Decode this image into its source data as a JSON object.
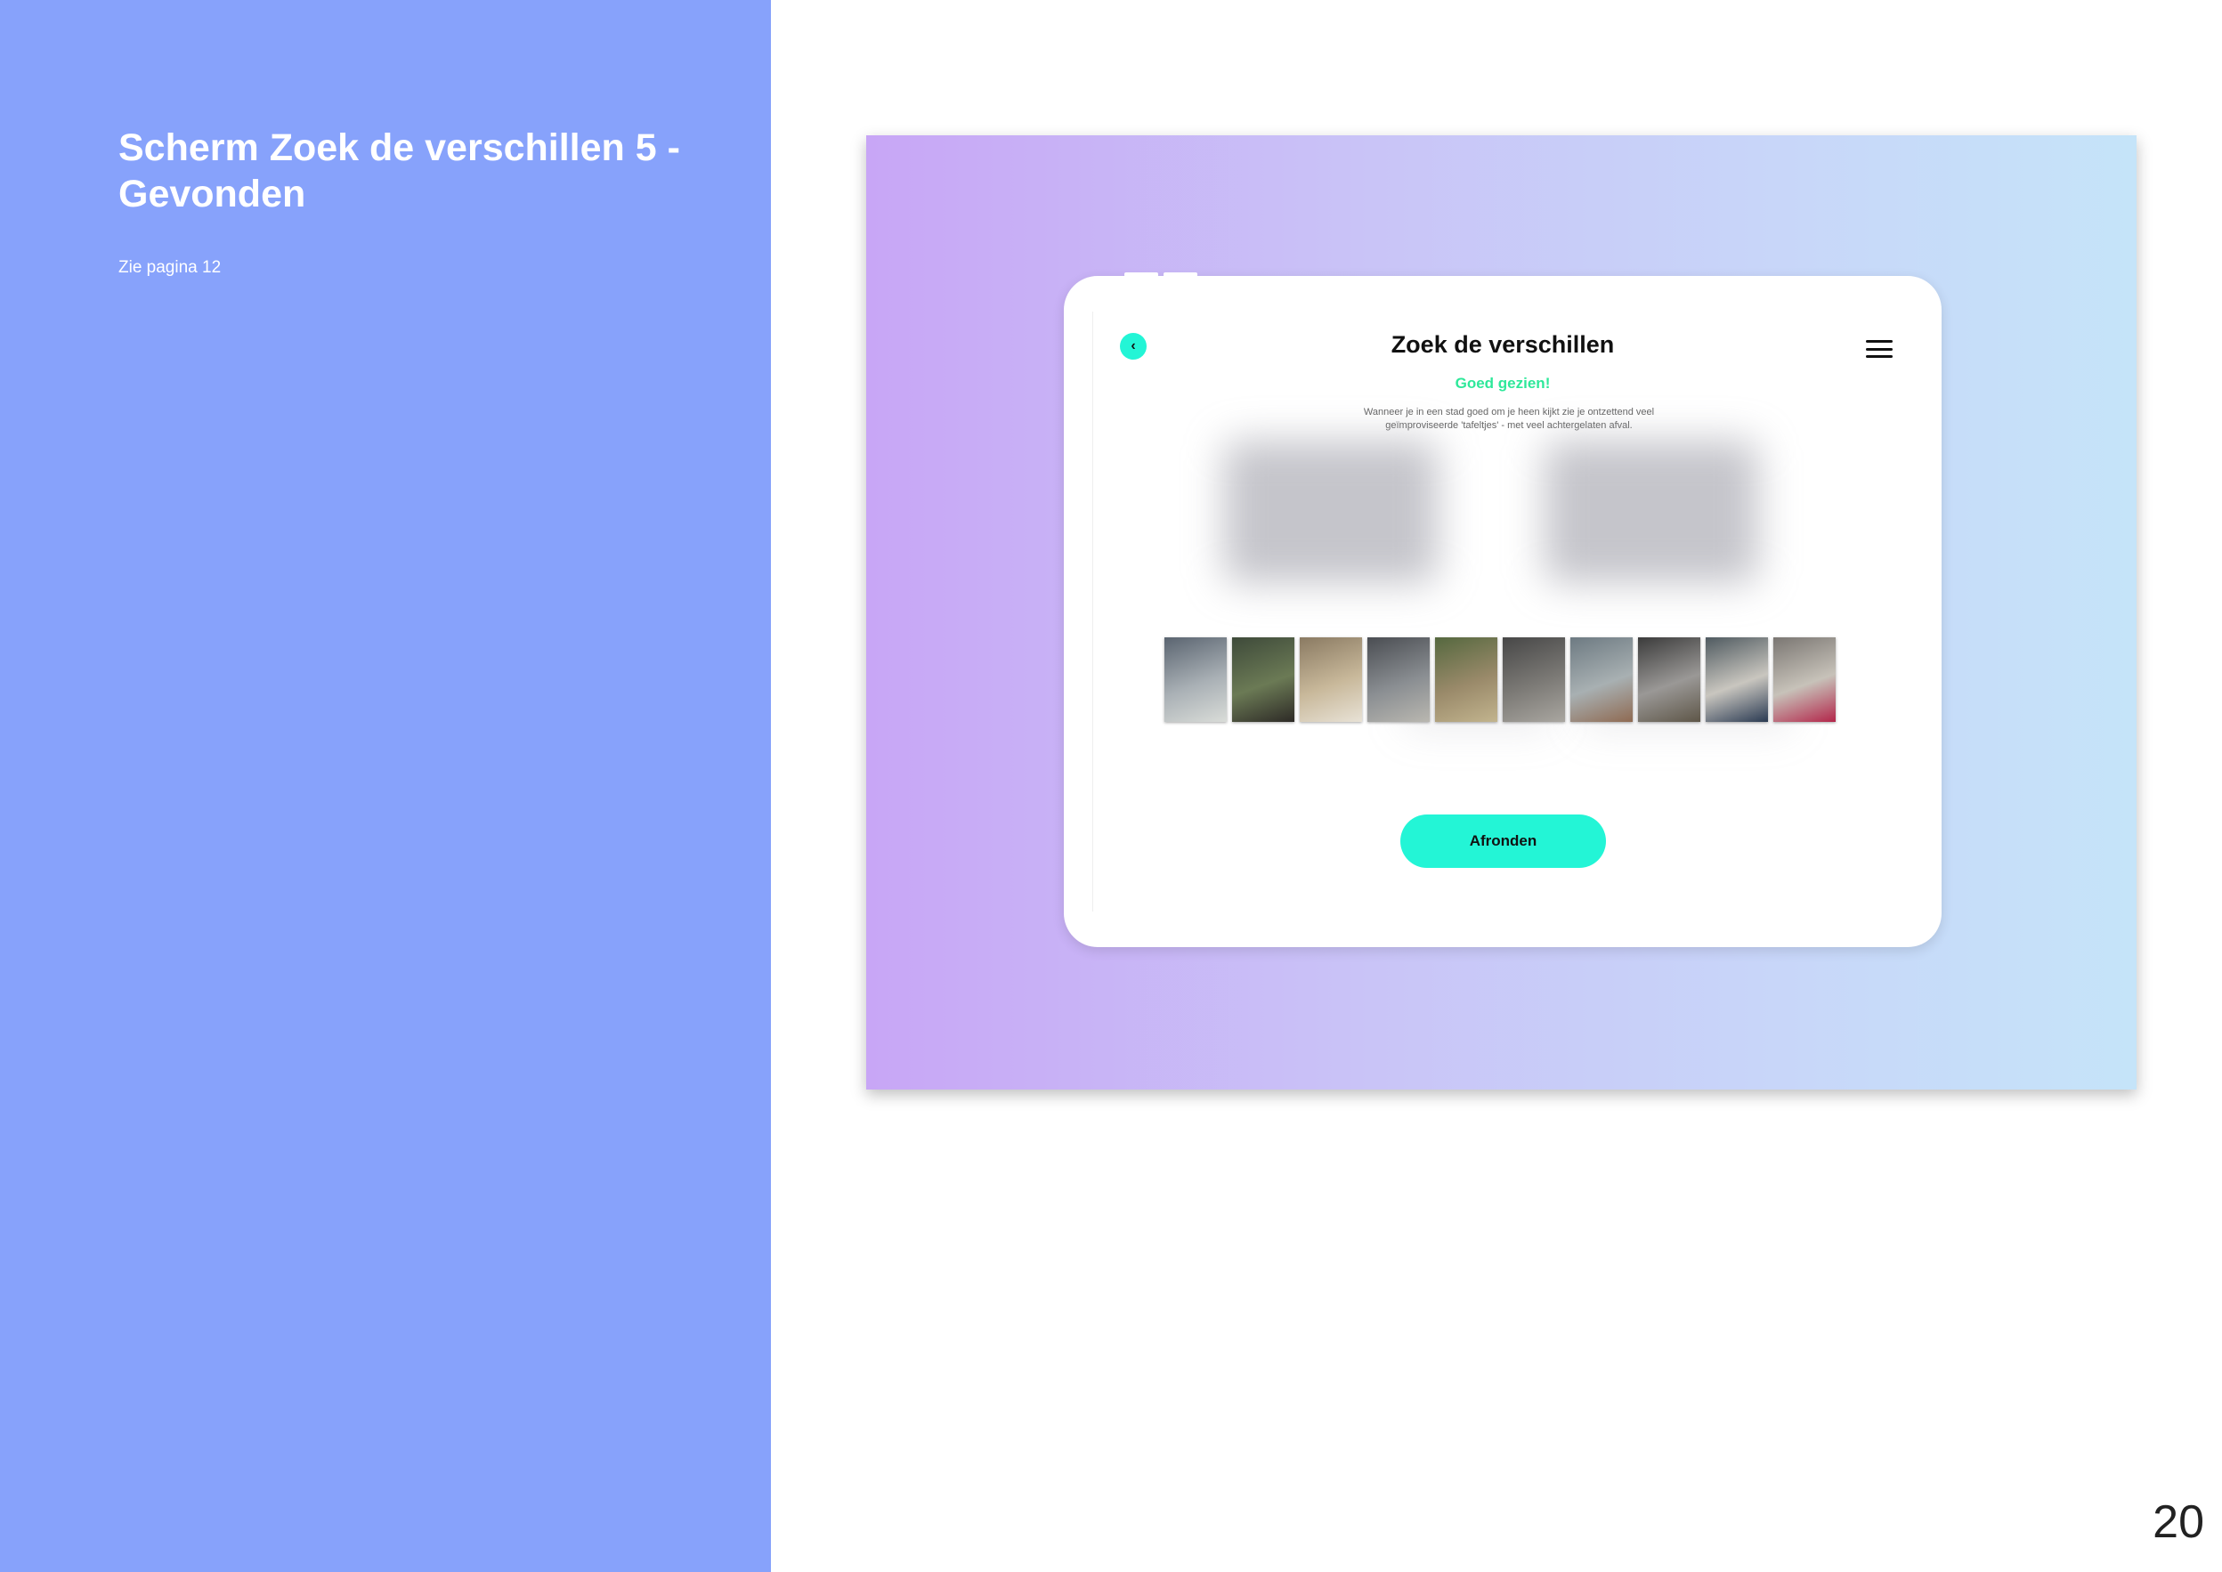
{
  "slide": {
    "title_line1": "Scherm Zoek de verschillen 5  -",
    "title_line2": "Gevonden",
    "subtitle": "Zie pagina 12",
    "page_number": "20",
    "panel_color": "#87a2fb"
  },
  "app": {
    "title": "Zoek de verschillen",
    "back_icon": "chevron-left-icon",
    "menu_icon": "hamburger-menu-icon",
    "status": "Goed gezien!",
    "description_line1": "Wanneer je in een stad goed om je heen kijkt zie je ontzettend veel",
    "description_line2": "geïmproviseerde  'tafeltjes' - met veel achtergelaten afval.",
    "done_label": "Afronden",
    "accent_color": "#23f5d6",
    "status_color": "#2ee89a"
  },
  "thumbnails": [
    {
      "name": "street-photo-1",
      "colors": [
        "#5a6470",
        "#a9b0b5",
        "#d9dcd8"
      ]
    },
    {
      "name": "street-photo-2",
      "colors": [
        "#3e4a3a",
        "#6b7a55",
        "#2d2a26"
      ]
    },
    {
      "name": "street-photo-3",
      "colors": [
        "#8a7a62",
        "#c8b89a",
        "#e8e2d6"
      ]
    },
    {
      "name": "street-photo-4",
      "colors": [
        "#4a4d52",
        "#8a8e92",
        "#b9b7b0"
      ]
    },
    {
      "name": "street-photo-5",
      "colors": [
        "#55683f",
        "#9a8a6a",
        "#c2b48e"
      ]
    },
    {
      "name": "street-photo-6",
      "colors": [
        "#474747",
        "#7c7a76",
        "#a9a6a0"
      ]
    },
    {
      "name": "street-photo-7",
      "colors": [
        "#6d7a82",
        "#a8b0b2",
        "#8f6a52"
      ]
    },
    {
      "name": "street-photo-8",
      "colors": [
        "#3b3b3b",
        "#9a9896",
        "#5e5648"
      ]
    },
    {
      "name": "street-photo-9",
      "colors": [
        "#4f5a60",
        "#c9c6bf",
        "#2a3a52"
      ]
    },
    {
      "name": "street-photo-10",
      "colors": [
        "#7a7672",
        "#c7c2b9",
        "#b3264a"
      ]
    }
  ]
}
